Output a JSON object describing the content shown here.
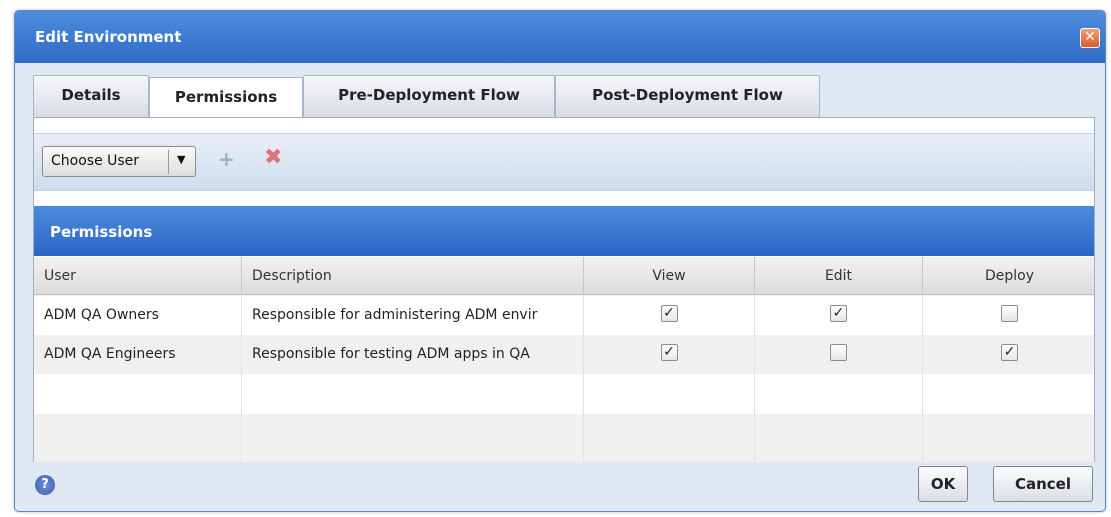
{
  "dialog": {
    "title": "Edit Environment",
    "close_symbol": "✕"
  },
  "tabs": [
    {
      "label": "Details",
      "active": false
    },
    {
      "label": "Permissions",
      "active": true
    },
    {
      "label": "Pre-Deployment Flow",
      "active": false
    },
    {
      "label": "Post-Deployment Flow",
      "active": false
    }
  ],
  "toolbar": {
    "choose_user_label": "Choose User",
    "dropdown_arrow": "▼",
    "add_icon": "+",
    "delete_icon": "✖"
  },
  "section": {
    "title": "Permissions"
  },
  "table": {
    "columns": [
      "User",
      "Description",
      "View",
      "Edit",
      "Deploy"
    ],
    "rows": [
      {
        "user": "ADM QA Owners",
        "description": "Responsible for administering ADM envir",
        "view": true,
        "edit": true,
        "deploy": false
      },
      {
        "user": "ADM QA Engineers",
        "description": "Responsible for testing ADM apps in QA",
        "view": true,
        "edit": false,
        "deploy": true
      }
    ]
  },
  "footer": {
    "help_symbol": "?",
    "ok_label": "OK",
    "cancel_label": "Cancel"
  },
  "colors": {
    "title_bar": "#3a78d4",
    "section_header": "#3a78d4",
    "close_button": "#e0693a"
  },
  "icons": [
    "close-icon",
    "dropdown-arrow-icon",
    "add-icon",
    "delete-icon",
    "checkbox-icon",
    "help-icon"
  ]
}
